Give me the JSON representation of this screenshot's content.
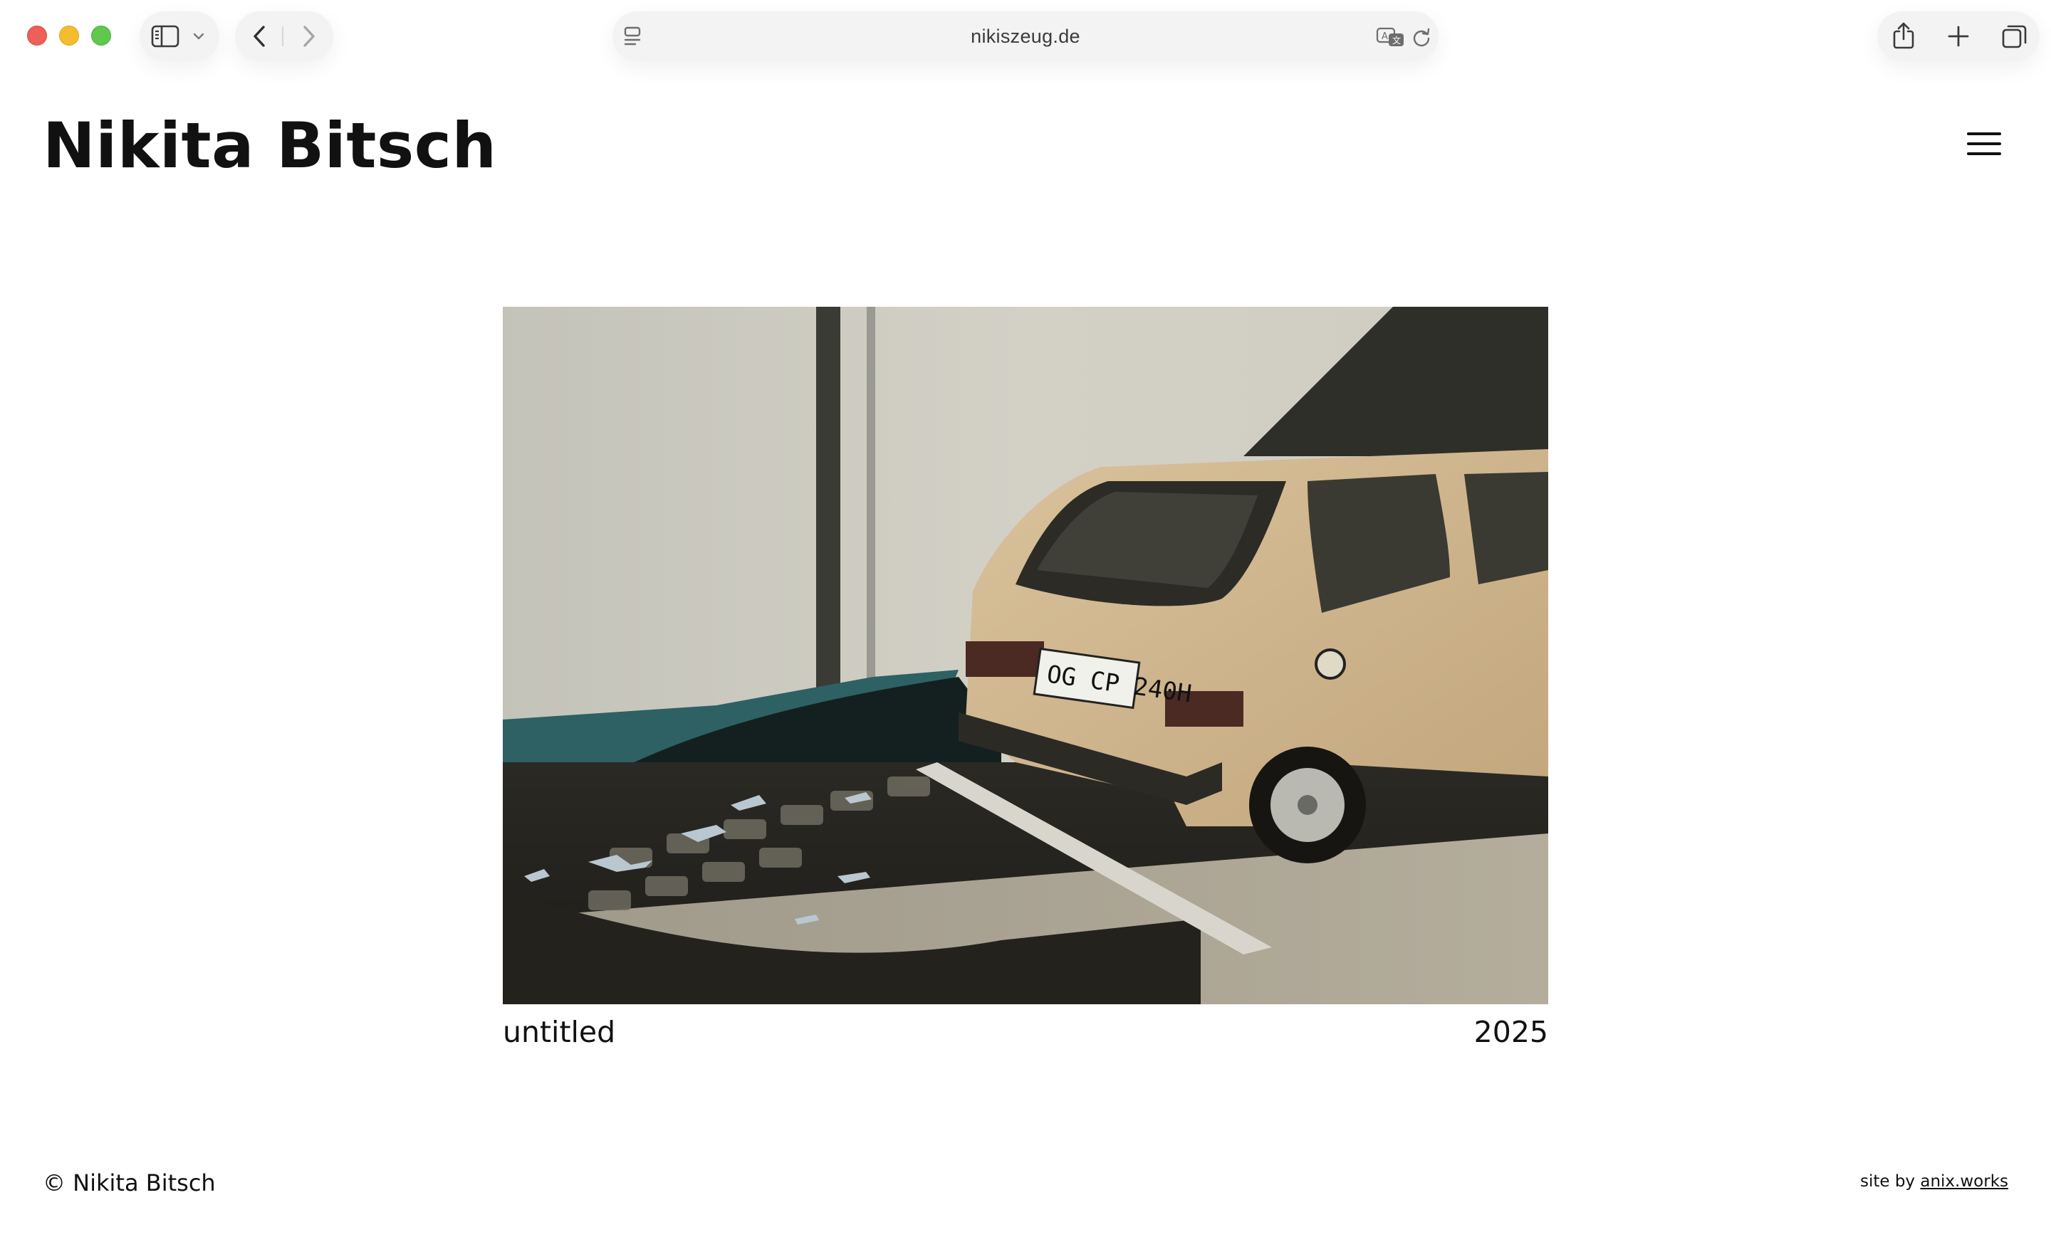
{
  "browser": {
    "url": "nikiszeug.de",
    "icons": {
      "sidebar": "sidebar-icon",
      "sidebar_menu": "chevron-down-icon",
      "back": "chevron-left-icon",
      "forward": "chevron-right-icon",
      "page_menu": "page-menu-icon",
      "translate": "translate-icon",
      "reload": "reload-icon",
      "share": "share-icon",
      "new_tab": "plus-icon",
      "tabs": "tab-overview-icon"
    }
  },
  "site": {
    "title": "Nikita Bitsch",
    "menu_icon": "hamburger-menu-icon"
  },
  "artwork": {
    "title": "untitled",
    "year": "2025",
    "image_subject": "beige hatchback parked by a textured wall in sunlight"
  },
  "footer": {
    "copyright": "© Nikita Bitsch",
    "credit_prefix": "site by",
    "credit_link": "anix.works"
  },
  "colors": {
    "traffic_red": "#ee5f57",
    "traffic_yellow": "#f5bd2e",
    "traffic_green": "#5fc84d",
    "text": "#111111",
    "background": "#ffffff"
  }
}
